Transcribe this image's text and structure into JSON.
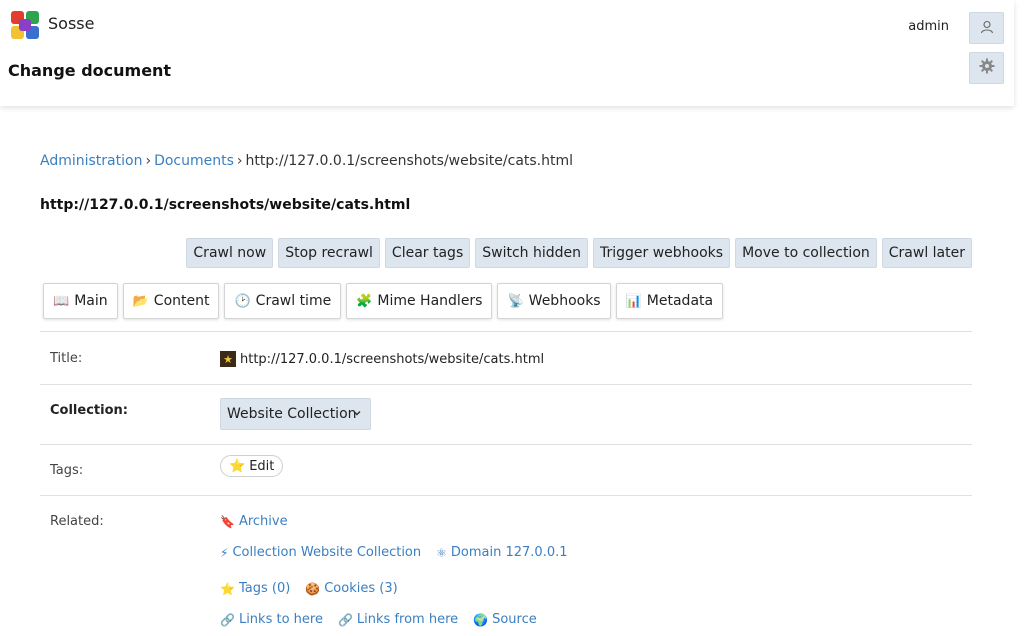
{
  "header": {
    "app_name": "Sosse",
    "page_title": "Change document",
    "user_name": "admin"
  },
  "breadcrumb": {
    "items": [
      "Administration",
      "Documents"
    ],
    "current": "http://127.0.0.1/screenshots/website/cats.html"
  },
  "document": {
    "heading": "http://127.0.0.1/screenshots/website/cats.html"
  },
  "actions": [
    "Crawl now",
    "Stop recrawl",
    "Clear tags",
    "Switch hidden",
    "Trigger webhooks",
    "Move to collection",
    "Crawl later"
  ],
  "tabs": [
    {
      "icon": "📖",
      "label": "Main"
    },
    {
      "icon": "📂",
      "label": "Content"
    },
    {
      "icon": "🕑",
      "label": "Crawl time"
    },
    {
      "icon": "🧩",
      "label": "Mime Handlers"
    },
    {
      "icon": "📡",
      "label": "Webhooks"
    },
    {
      "icon": "📊",
      "label": "Metadata"
    }
  ],
  "form": {
    "title_label": "Title:",
    "title_value": "http://127.0.0.1/screenshots/website/cats.html",
    "collection_label": "Collection:",
    "collection_value": "Website Collection",
    "tags_label": "Tags:",
    "tags_edit": "Edit",
    "related_label": "Related:",
    "related": {
      "archive": "Archive",
      "collection": "Collection Website Collection",
      "domain": "Domain 127.0.0.1",
      "tags": "Tags (0)",
      "cookies": "Cookies (3)",
      "links_to": "Links to here",
      "links_from": "Links from here",
      "source": "Source"
    }
  },
  "colors": {
    "accent": "#3a7fc1",
    "button_bg": "#dde6ee"
  }
}
